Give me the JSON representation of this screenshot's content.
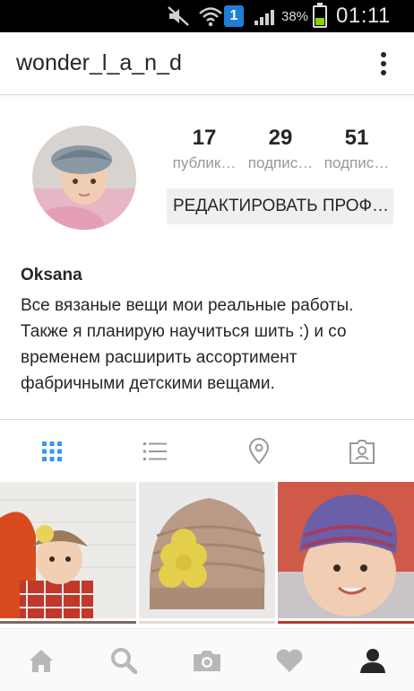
{
  "status_bar": {
    "sim_badge": "1",
    "battery_percent": "38%",
    "battery_level": 0.38,
    "time": "01:11"
  },
  "app_bar": {
    "username": "wonder_l_a_n_d",
    "menu_icon": "more-vert-icon"
  },
  "profile": {
    "stats": [
      {
        "value": "17",
        "label": "публик…"
      },
      {
        "value": "29",
        "label": "подпис…"
      },
      {
        "value": "51",
        "label": "подпис…"
      }
    ],
    "edit_button_label": "РЕДАКТИРОВАТЬ ПРОФ…",
    "full_name": "Oksana",
    "bio": "Все вязаные вещи мои реальные работы.\nТакже я планирую научиться шить :) и со\nвременем расширить ассортимент\nфабричными детскими вещами."
  },
  "tabs": [
    {
      "icon": "grid-icon",
      "active": true
    },
    {
      "icon": "list-icon",
      "active": false
    },
    {
      "icon": "location-pin-icon",
      "active": false
    },
    {
      "icon": "tagged-photos-icon",
      "active": false
    }
  ],
  "bottom_nav": [
    {
      "icon": "home-icon"
    },
    {
      "icon": "search-icon"
    },
    {
      "icon": "camera-icon"
    },
    {
      "icon": "heart-icon"
    },
    {
      "icon": "profile-icon",
      "active": true
    }
  ],
  "colors": {
    "accent_blue": "#3897f0",
    "icon_gray": "#999999",
    "button_bg": "#efefef"
  }
}
